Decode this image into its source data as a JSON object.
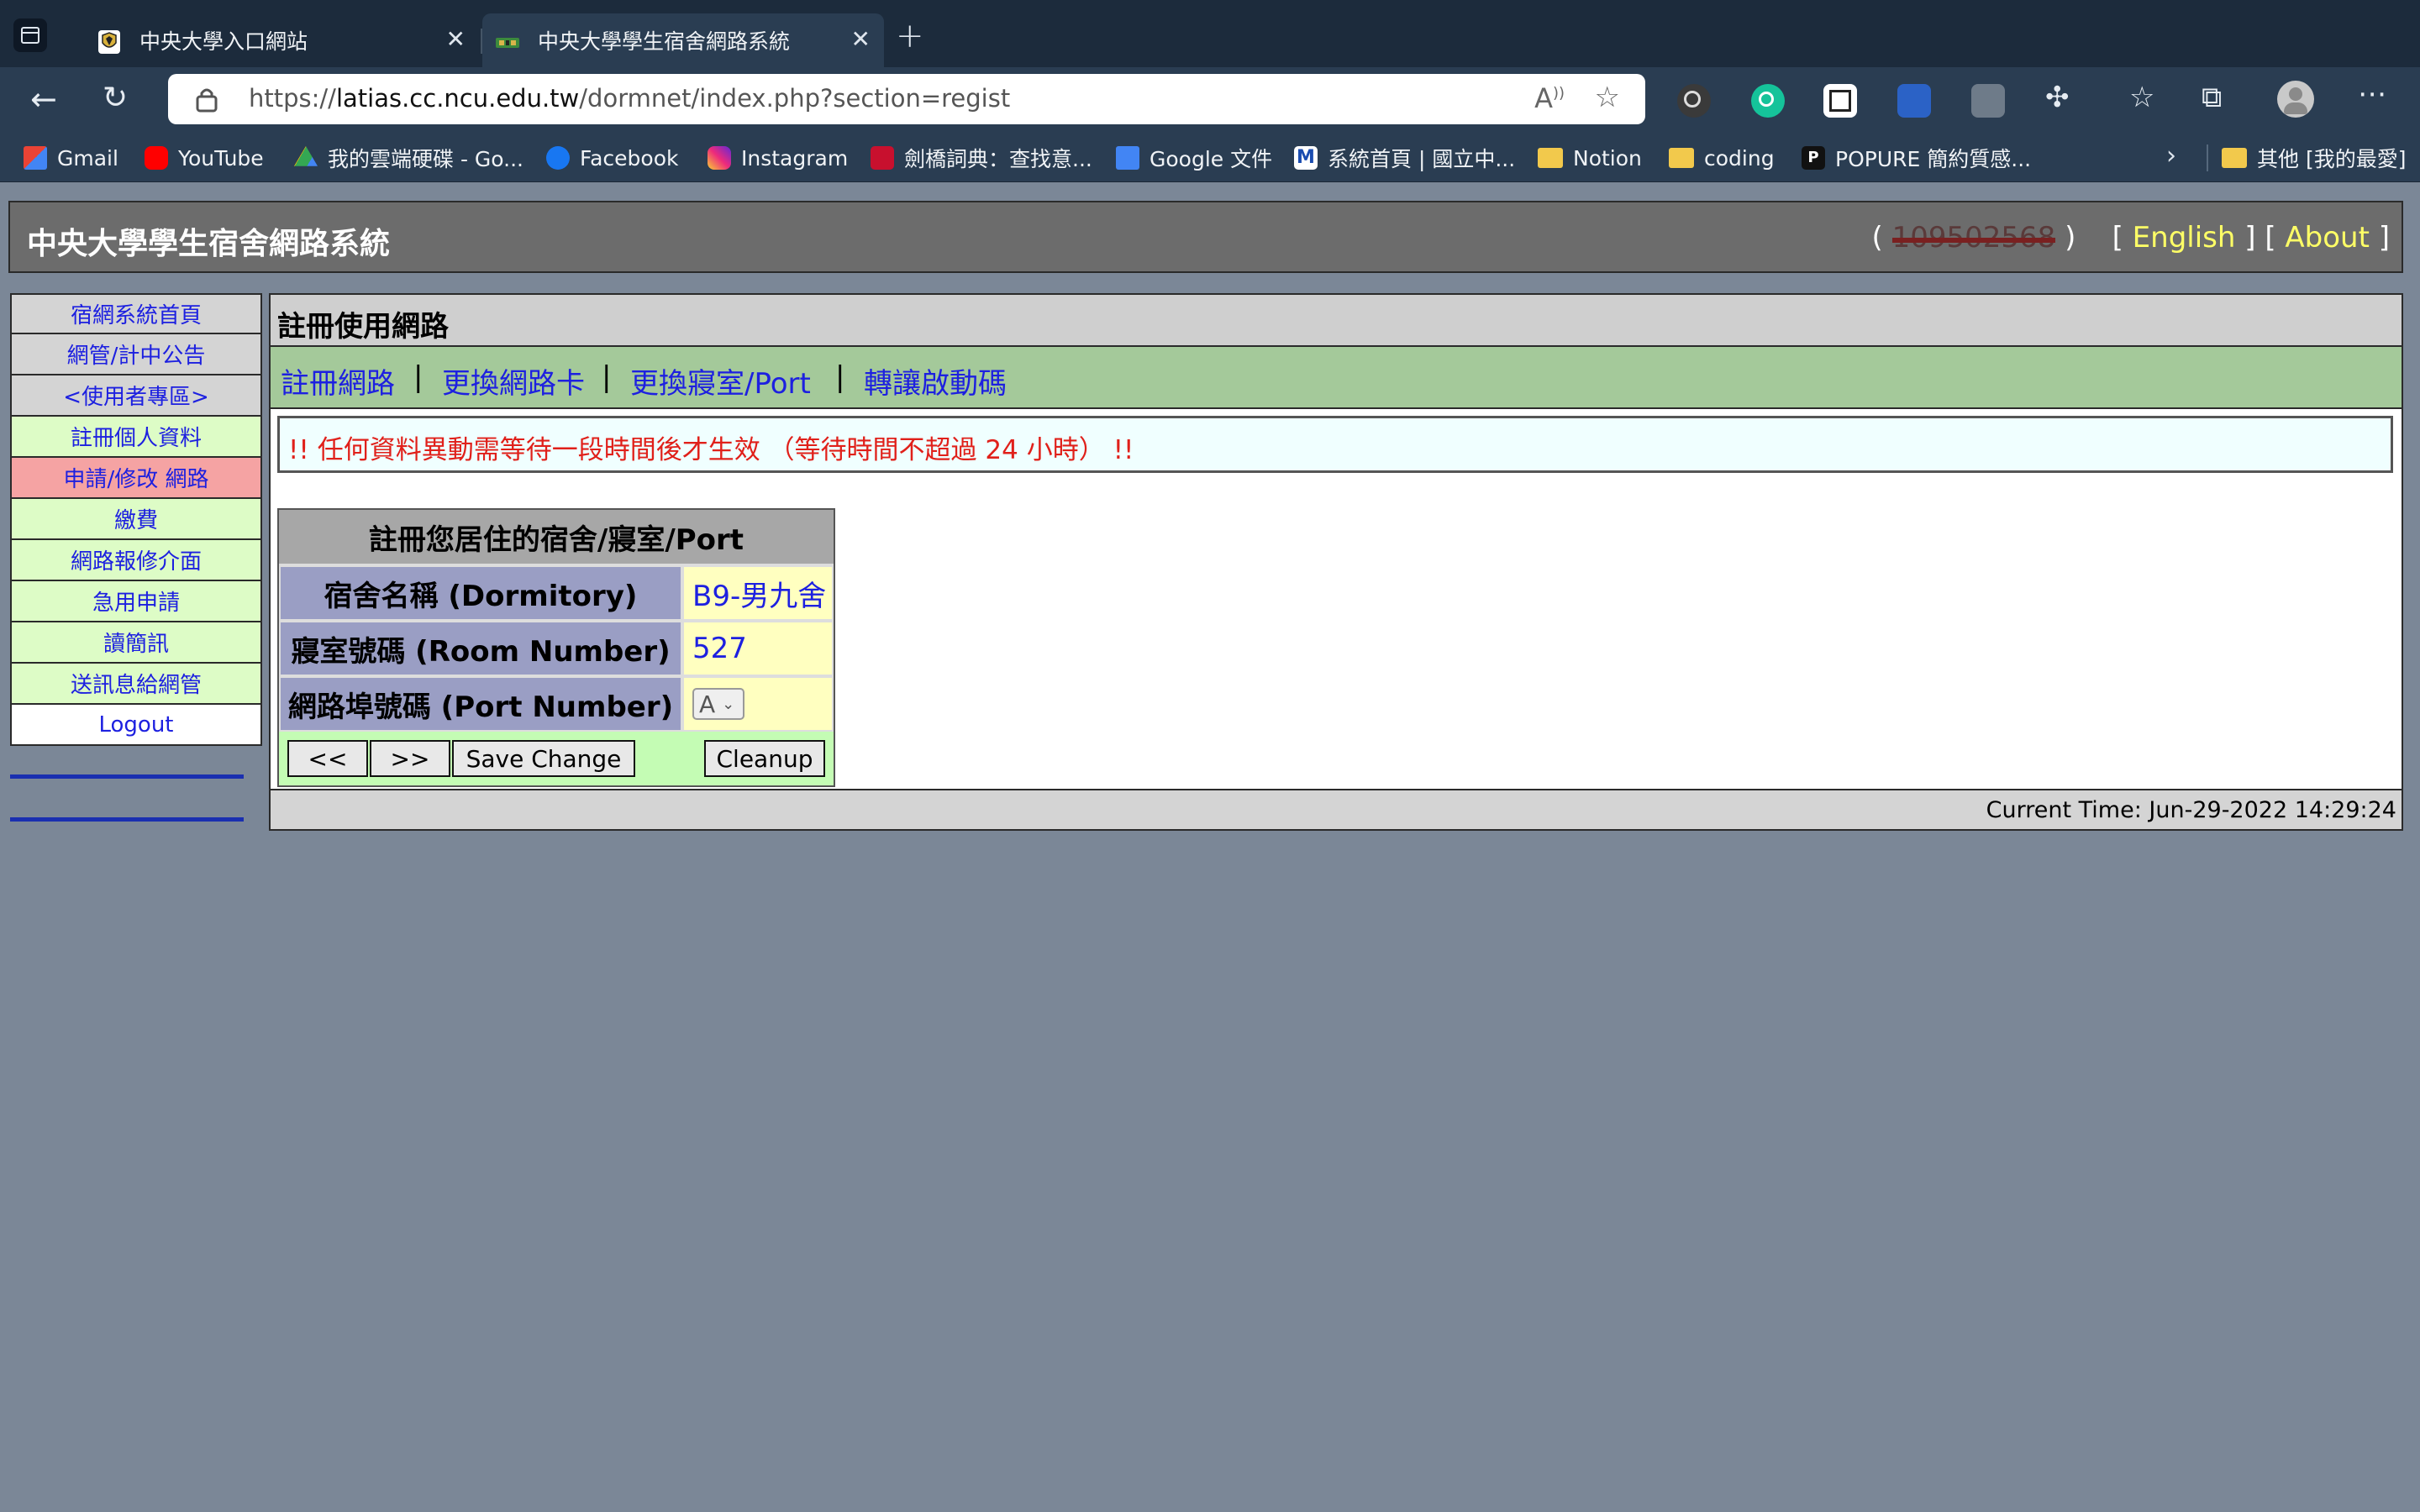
{
  "browser": {
    "tabs": [
      {
        "title": "中央大學入口網站",
        "active": false
      },
      {
        "title": "中央大學學生宿舍網路系統",
        "active": true
      }
    ],
    "url_prefix": "https://",
    "url_host": "latias.cc.ncu.edu.tw",
    "url_path": "/dormnet/index.php?section=regist",
    "bookmarks": [
      {
        "label": "Gmail"
      },
      {
        "label": "YouTube"
      },
      {
        "label": "我的雲端硬碟 - Go..."
      },
      {
        "label": "Facebook"
      },
      {
        "label": "Instagram"
      },
      {
        "label": "劍橋詞典：查找意..."
      },
      {
        "label": "Google 文件"
      },
      {
        "label": "系統首頁 | 國立中..."
      },
      {
        "label": "Notion"
      },
      {
        "label": "coding"
      },
      {
        "label": "POPURE 簡約質感..."
      },
      {
        "label": "其他 [我的最愛]"
      }
    ]
  },
  "header": {
    "system_title": "中央大學學生宿舍網路系統",
    "user_id": "109502568",
    "english_link": "English",
    "about_link": "About"
  },
  "sidebar": {
    "items": [
      {
        "label": "宿網系統首頁"
      },
      {
        "label": "網管/計中公告"
      },
      {
        "label": "<使用者專區>"
      },
      {
        "label": "註冊個人資料"
      },
      {
        "label": "申請/修改 網路"
      },
      {
        "label": "繳費"
      },
      {
        "label": "網路報修介面"
      },
      {
        "label": "急用申請"
      },
      {
        "label": "讀簡訊"
      },
      {
        "label": "送訊息給網管"
      },
      {
        "label": "Logout"
      }
    ]
  },
  "main": {
    "section_title": "註冊使用網路",
    "links": [
      "註冊網路",
      "更換網路卡",
      "更換寢室/Port",
      "轉讓啟動碼"
    ],
    "notice": "!! 任何資料異動需等待一段時間後才生效 （等待時間不超過 24 小時） !!",
    "form": {
      "heading": "註冊您居住的宿舍/寢室/Port",
      "dormitory_label": "宿舍名稱 (Dormitory)",
      "dormitory_value": "B9-男九舍",
      "room_label": "寢室號碼 (Room Number)",
      "room_value": "527",
      "port_label": "網路埠號碼 (Port Number)",
      "port_value": "A",
      "prev_button": "<<",
      "next_button": ">>",
      "save_button": "Save Change",
      "cleanup_button": "Cleanup"
    },
    "current_time": "Current Time: Jun-29-2022 14:29:24"
  }
}
